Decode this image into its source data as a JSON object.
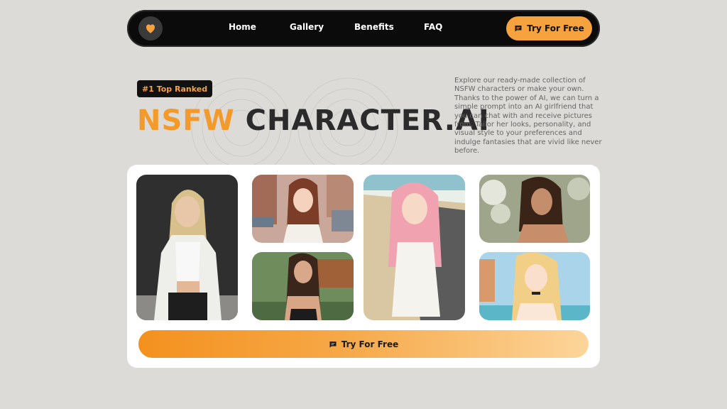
{
  "nav": {
    "logo_icon": "heart-icon",
    "links": [
      "Home",
      "Gallery",
      "Benefits",
      "FAQ"
    ],
    "cta_label": "Try For Free",
    "cta_icon": "chat-icon"
  },
  "hero": {
    "badge": "#1 Top Ranked",
    "title_accent": "NSFW",
    "title_main": "CHARACTER.AI",
    "description": "Explore our ready-made collection of NSFW characters or make your own. Thanks to the power of AI, we can turn a simple prompt into an AI girlfriend that you can chat with and receive pictures from. Tailor her looks, personality, and visual style to your preferences and indulge fantasies that are vivid like never before."
  },
  "gallery": {
    "cta_label": "Try For Free",
    "cta_icon": "chat-icon"
  },
  "colors": {
    "accent": "#f39a2a",
    "background": "#dcdbd7",
    "navbar": "#0b0b0b"
  }
}
